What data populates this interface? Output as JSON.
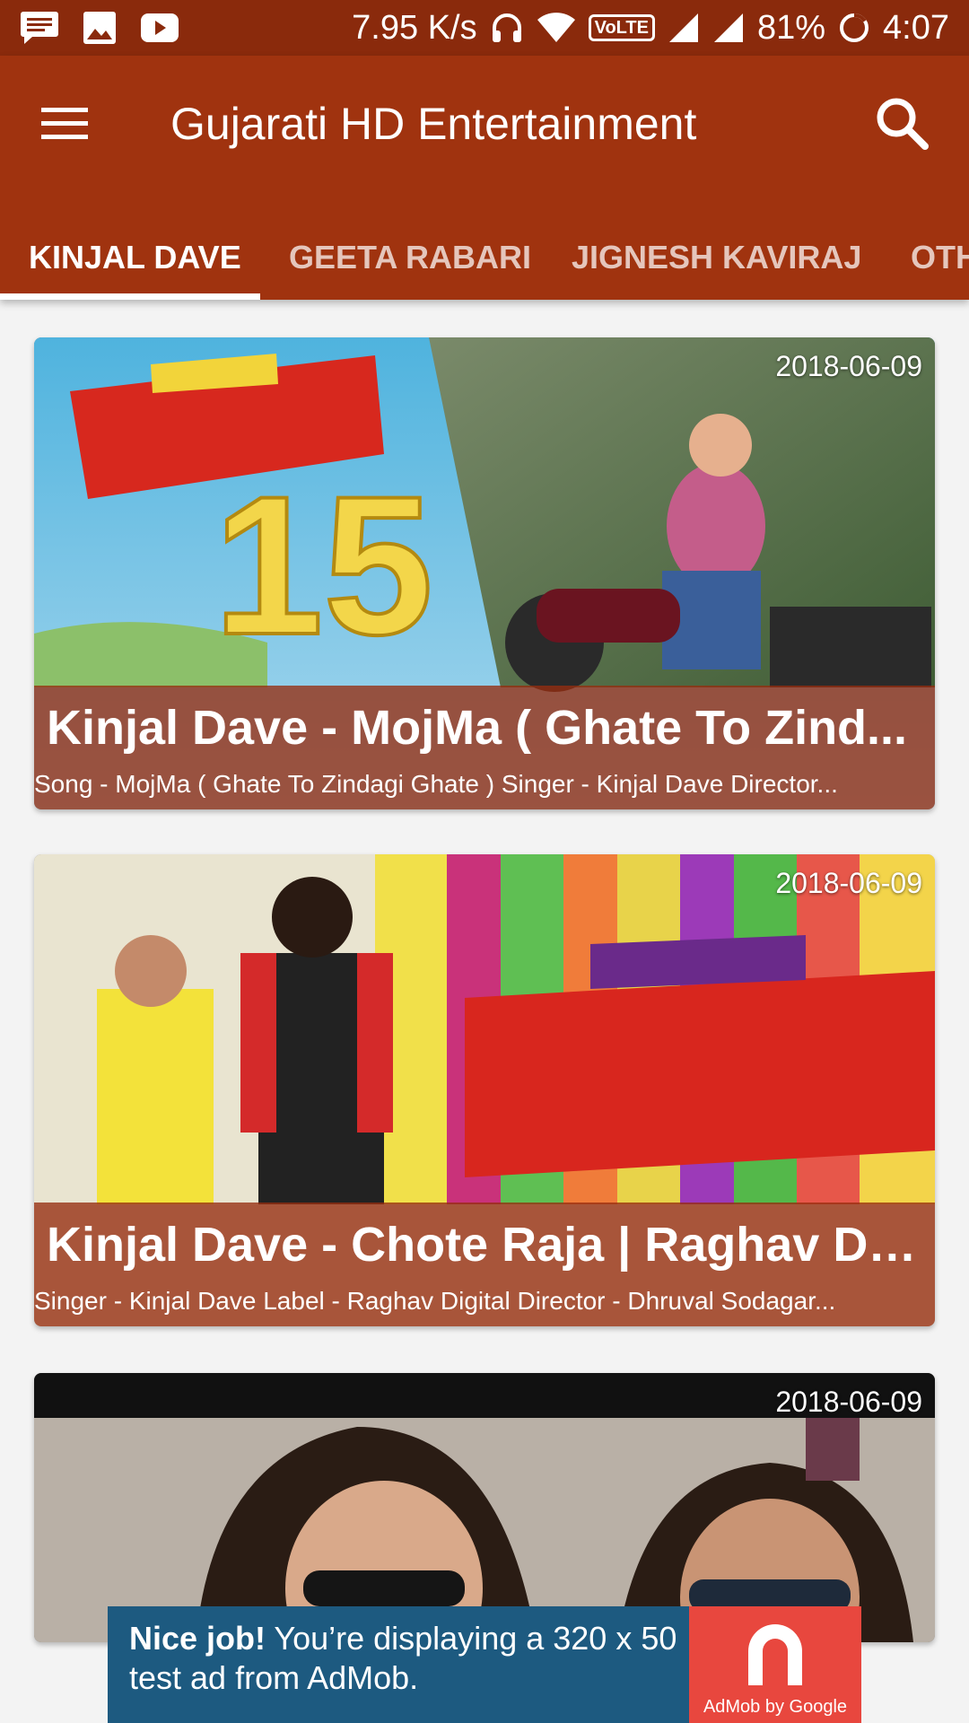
{
  "status_bar": {
    "network_speed": "7.95 K/s",
    "volte": "VoLTE",
    "battery": "81%",
    "time": "4:07",
    "icons": [
      "message-icon",
      "image-icon",
      "youtube-icon",
      "headphones-icon",
      "wifi-icon",
      "volte-icon",
      "signal-icon",
      "signal-icon",
      "battery-icon"
    ]
  },
  "toolbar": {
    "title": "Gujarati HD Entertainment",
    "menu_icon": "hamburger-menu-icon",
    "search_icon": "search-icon"
  },
  "tabs": [
    {
      "label": "KINJAL DAVE",
      "active": true
    },
    {
      "label": "GEETA RABARI",
      "active": false
    },
    {
      "label": "JIGNESH KAVIRAJ",
      "active": false
    },
    {
      "label": "OTH",
      "active": false
    }
  ],
  "videos": [
    {
      "date": "2018-06-09",
      "title": "Kinjal Dave - MojMa ( Ghate To Zind...",
      "description": "Song - MojMa ( Ghate To Zindagi Ghate ) Singer - Kinjal Dave Director..."
    },
    {
      "date": "2018-06-09",
      "title": "Kinjal Dave - Chote Raja | Raghav Di...",
      "description": "Singer - Kinjal Dave Label - Raghav Digital Director - Dhruval Sodagar..."
    },
    {
      "date": "2018-06-09"
    }
  ],
  "ad": {
    "bold": "Nice job!",
    "text": "You’re displaying a 320 x 50 test ad from AdMob.",
    "label": "AdMob by Google"
  },
  "colors": {
    "status_bar": "#8a2a0c",
    "app_bar": "#a0330f",
    "caption_overlay": "#962d0f",
    "ad_background": "#1d5a80",
    "ad_logo": "#e8473e"
  }
}
